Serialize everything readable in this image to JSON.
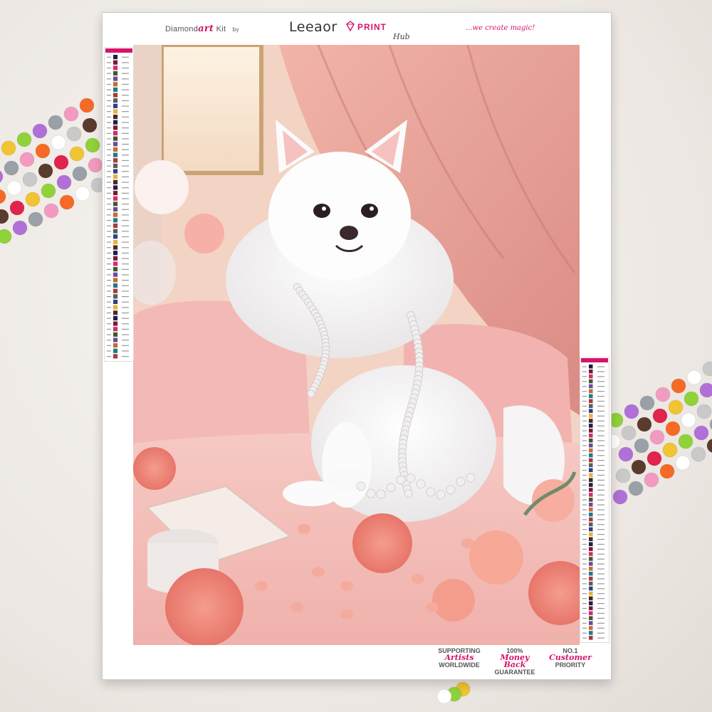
{
  "header": {
    "brand_diamond": "Diamond",
    "brand_art": "art",
    "brand_kit": "Kit",
    "brand_by": "by",
    "brand_name": "Leeaor",
    "brand_print": "PRINT",
    "brand_hub": "Hub",
    "tagline": "...we create magic!"
  },
  "artwork": {
    "subject": "white-pomeranian-with-pearls",
    "palette": {
      "curtain": "#e9a9a0",
      "pillow": "#f1b8b6",
      "bed": "#f4c6c2",
      "dog": "#fbfbfb",
      "rose": "#f08a7a",
      "window_light": "#fbead8"
    }
  },
  "legend_left": {
    "rows": 56
  },
  "legend_right": {
    "rows": 56
  },
  "footer": {
    "badge1_top": "SUPPORTING",
    "badge1_script": "Artists",
    "badge1_bottom": "WORLDWIDE",
    "badge2_top": "100%",
    "badge2_script": "Money Back",
    "badge2_bottom": "GUARANTEE",
    "badge3_top": "NO.1",
    "badge3_script": "Customer",
    "badge3_bottom": "PRIORITY"
  }
}
